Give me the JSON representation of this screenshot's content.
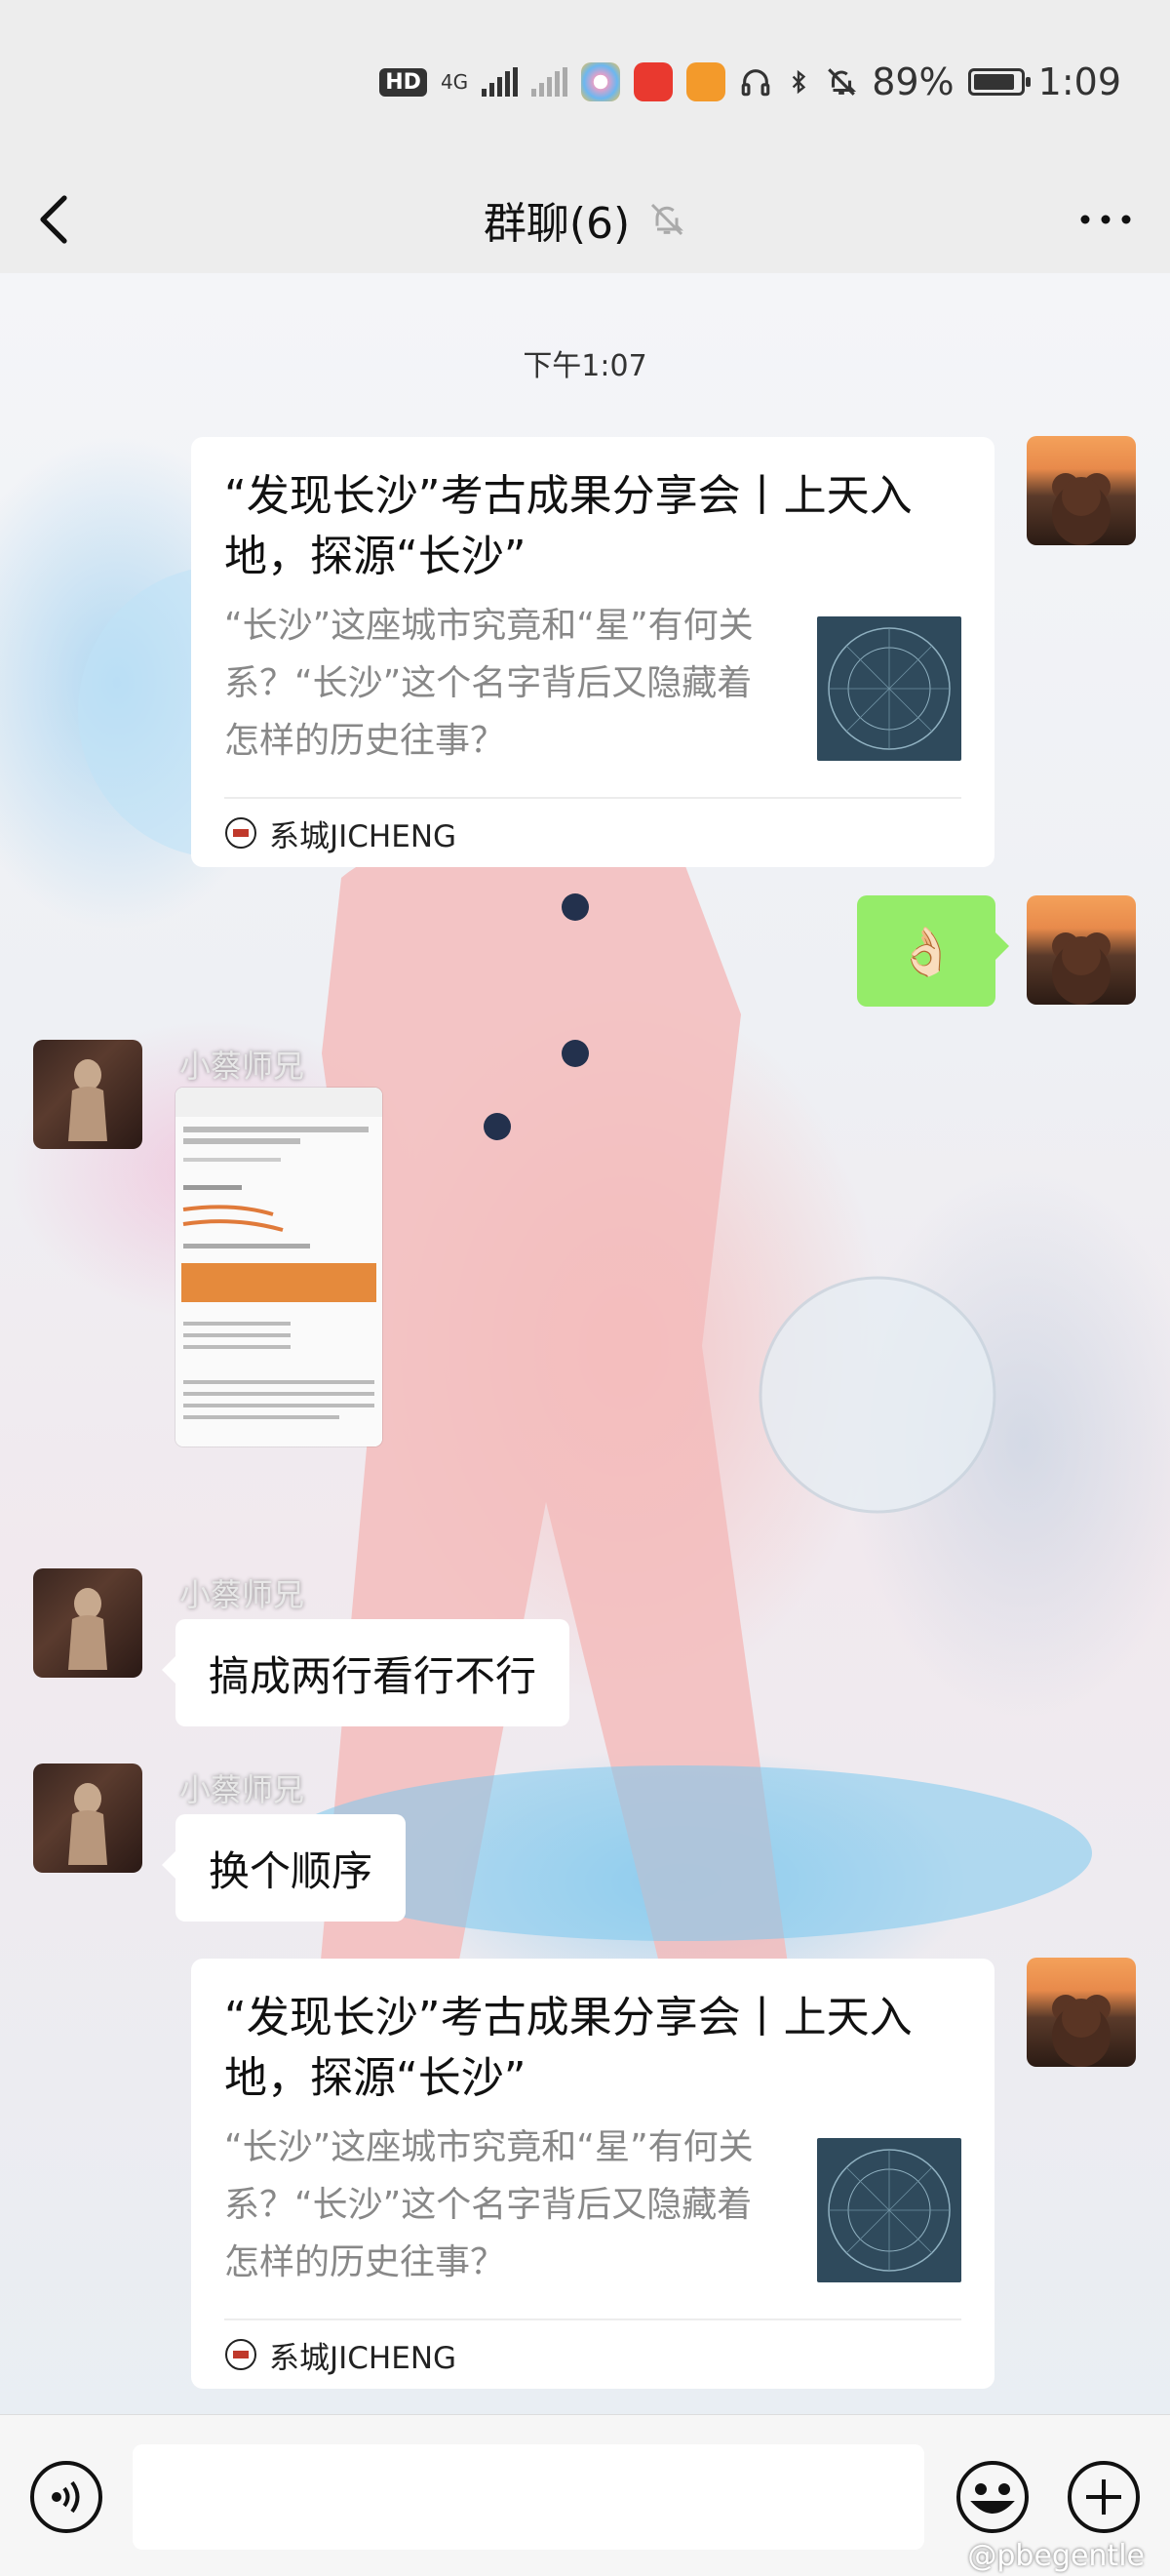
{
  "status_bar": {
    "hd_badge": "HD",
    "network": "4G",
    "battery_percent": "89%",
    "time": "1:09"
  },
  "nav": {
    "title": "群聊(6)"
  },
  "chat": {
    "time_divider": "下午1:07",
    "messages": [
      {
        "type": "link_card",
        "side": "right",
        "title": "“发现长沙”考古成果分享会丨上天入地，探源“长沙”",
        "description": "“长沙”这座城市究竟和“星”有何关系？“长沙”这个名字背后又隐藏着怎样的历史往事？",
        "source": "系城JICHENG"
      },
      {
        "type": "emoji",
        "side": "right",
        "content": "👌🏻"
      },
      {
        "type": "image",
        "side": "left",
        "sender": "小蔡师兄"
      },
      {
        "type": "text",
        "side": "left",
        "sender": "小蔡师兄",
        "content": "搞成两行看行不行"
      },
      {
        "type": "text",
        "side": "left",
        "sender": "小蔡师兄",
        "content": "换个顺序"
      },
      {
        "type": "link_card",
        "side": "right",
        "title": "“发现长沙”考古成果分享会丨上天入地，探源“长沙”",
        "description": "“长沙”这座城市究竟和“星”有何关系？“长沙”这个名字背后又隐藏着怎样的历史往事？",
        "source": "系城JICHENG"
      }
    ]
  },
  "watermark": "@pbegentle",
  "colors": {
    "own_bubble": "#95ec69",
    "bar_bg": "#ededed"
  }
}
